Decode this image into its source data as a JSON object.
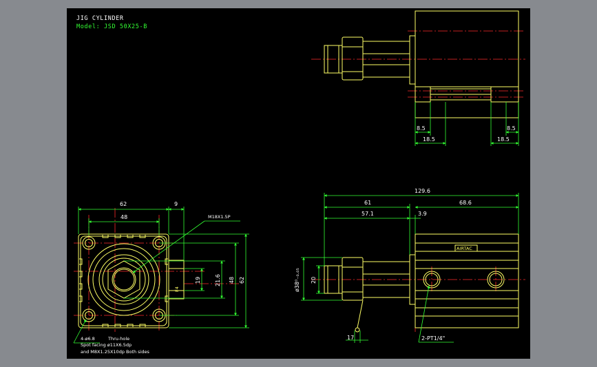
{
  "title_block": {
    "title": "JIG CYLINDER",
    "model": "Model: JSD 50X25-B"
  },
  "dimensions": {
    "top_right": {
      "left_width": "8.5",
      "right_width": "8.5",
      "left_span": "18.5",
      "right_span": "18.5"
    },
    "front": {
      "width": "62",
      "offset": "9",
      "inner_width": "48",
      "thread_label": "M18X1.5P",
      "port_height": "19",
      "inner_height": "21.6",
      "pitch_height": "48",
      "total_height": "62"
    },
    "side": {
      "total_length": "129.6",
      "rod_length": "61",
      "body_length": "68.6",
      "rod_inner": "57.1",
      "offset": "3.9",
      "bore_label": "ø38⁰₋₀.₀₅",
      "rod_dia": "20",
      "wrench": "17",
      "port_label": "2-PT1/4\""
    }
  },
  "notes": {
    "hole": "4-ø6.8",
    "thru": "Thru-hole",
    "spot": "Spot facing ø11X6.5dp",
    "tap": "and M8X1.25X10dp Both sides",
    "aux_mark": "F4",
    "nameplate": "AIRTAC"
  },
  "colors": {
    "sheet": "#000000",
    "frame": "#878a8f",
    "outline": "#ffff66",
    "dimension": "#33ff33",
    "centerline": "#ff2a2a",
    "text": "#ffffff"
  }
}
